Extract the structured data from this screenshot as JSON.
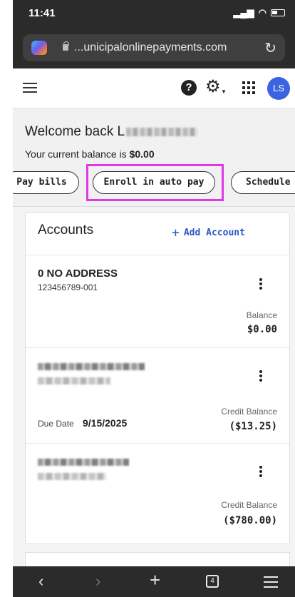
{
  "status_bar": {
    "time": "11:41"
  },
  "browser": {
    "url": "...unicipalonlinepayments.com"
  },
  "header": {
    "avatar_initials": "LS"
  },
  "welcome": {
    "greeting": "Welcome back L",
    "balance_prefix": "Your current balance is ",
    "balance_value": "$0.00"
  },
  "actions": {
    "pay_bills": "Pay bills",
    "enroll": "Enroll in auto pay",
    "schedule": "Schedule"
  },
  "accounts": {
    "title": "Accounts",
    "add_label": "Add Account",
    "items": [
      {
        "name": "0 NO ADDRESS",
        "number": "123456789-001",
        "balance_label": "Balance",
        "balance": "$0.00"
      },
      {
        "due_label": "Due Date",
        "due_date": "9/15/2025",
        "balance_label": "Credit Balance",
        "balance": "($13.25)"
      },
      {
        "balance_label": "Credit Balance",
        "balance": "($780.00)"
      }
    ]
  },
  "bottom_bar": {
    "tab_count": "4"
  },
  "colors": {
    "accent": "#2a57c8",
    "highlight": "#e038e6",
    "avatar": "#3c63e0"
  }
}
